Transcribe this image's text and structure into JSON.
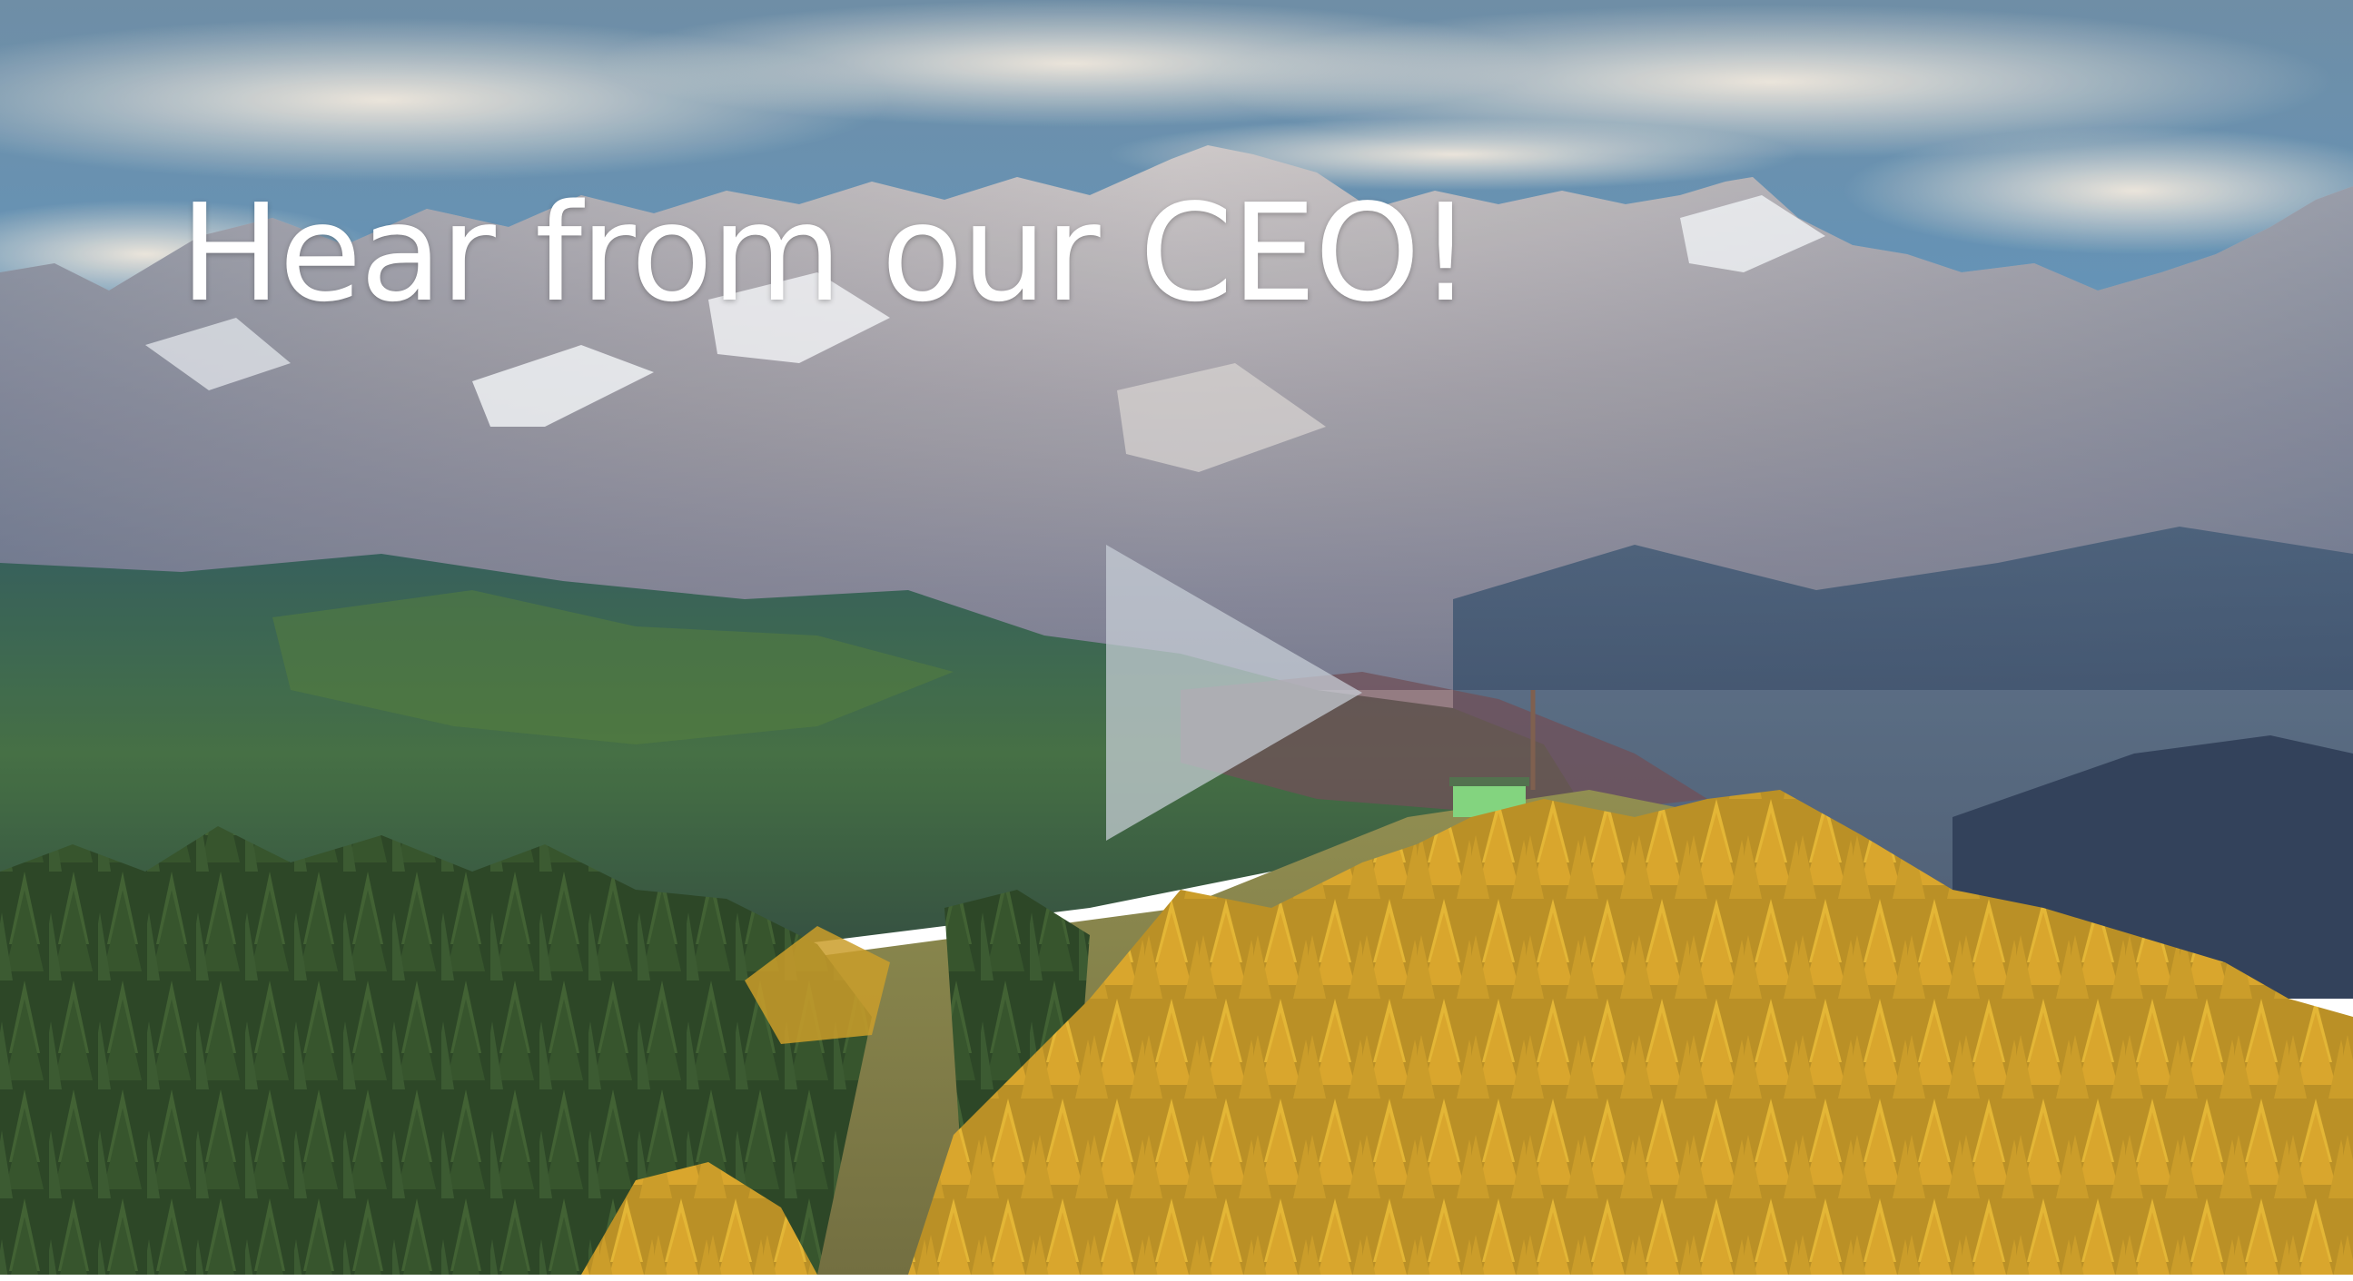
{
  "headline": "Hear from our CEO!",
  "colors": {
    "headline_text": "#ffffff",
    "play_button": "#b9c4cf",
    "sky_top": "#3f6f92",
    "clouds": "#ece5da",
    "forest_autumn": "#d4a52a",
    "forest_dark": "#2e4a26"
  },
  "icons": {
    "play": "play-icon"
  }
}
